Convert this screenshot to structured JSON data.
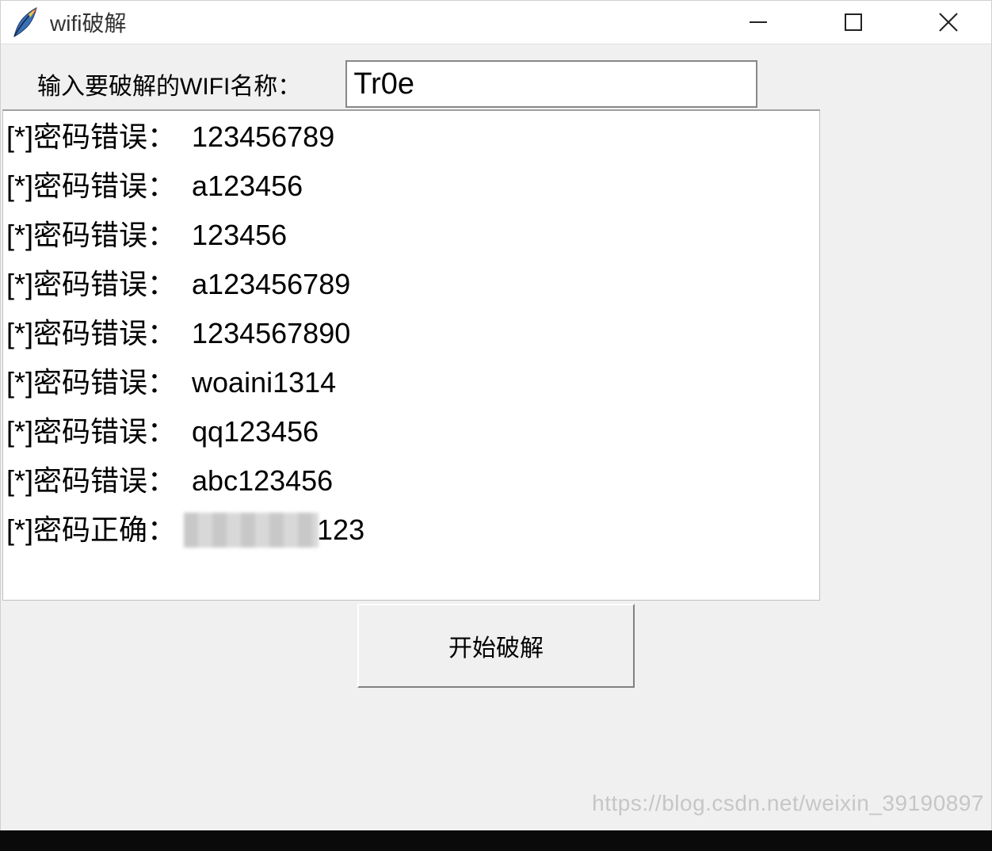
{
  "window": {
    "title": "wifi破解"
  },
  "form": {
    "wifi_label": "输入要破解的WIFI名称：",
    "wifi_value": "Tr0e"
  },
  "log": {
    "prefix": "[*]",
    "wrong_label": "密码错误：",
    "correct_label": "密码正确：",
    "lines": [
      {
        "status": "wrong",
        "value": "123456789"
      },
      {
        "status": "wrong",
        "value": "a123456"
      },
      {
        "status": "wrong",
        "value": "123456"
      },
      {
        "status": "wrong",
        "value": "a123456789"
      },
      {
        "status": "wrong",
        "value": "1234567890"
      },
      {
        "status": "wrong",
        "value": "woaini1314"
      },
      {
        "status": "wrong",
        "value": "qq123456"
      },
      {
        "status": "wrong",
        "value": "abc123456"
      },
      {
        "status": "correct",
        "redacted": true,
        "value_suffix": "123"
      }
    ]
  },
  "button": {
    "start_label": "开始破解"
  },
  "watermark": "https://blog.csdn.net/weixin_39190897"
}
